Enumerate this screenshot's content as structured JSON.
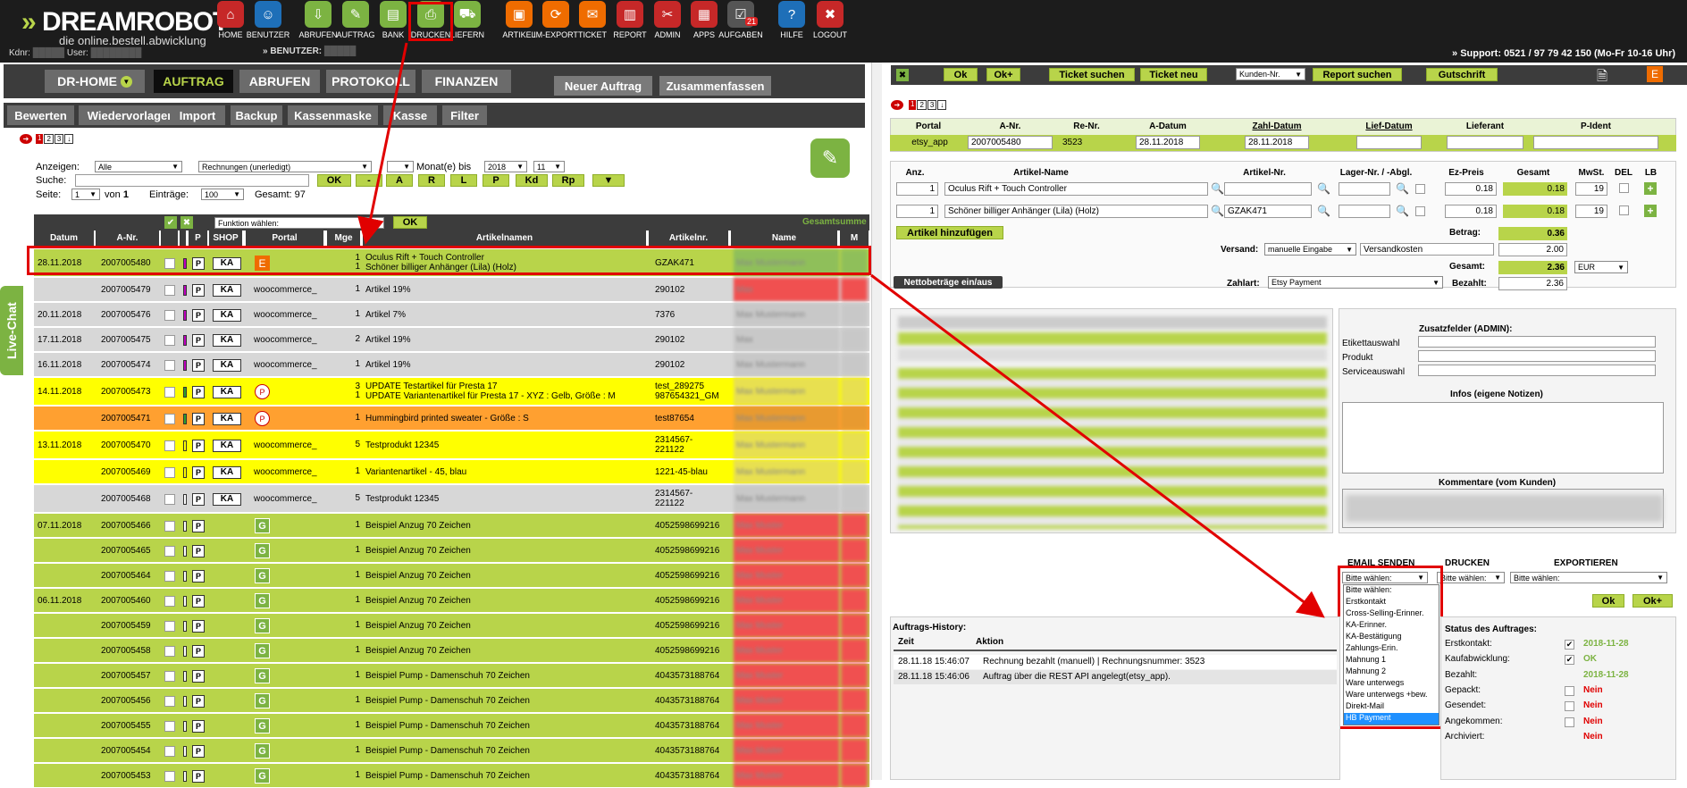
{
  "brand": {
    "name_a": "DREAM",
    "name_b": "ROBOT",
    "tagline": "die online.bestell.abwicklung",
    "kdnr_label": "Kdnr:",
    "user_label": "User:",
    "benutzer_label": "BENUTZER:",
    "support": "Support: 0521 / 97 79 42 150 (Mo-Fr 10-16 Uhr)"
  },
  "nav": [
    {
      "label": "HOME",
      "icon": "home-icon",
      "color": "#c62828"
    },
    {
      "label": "BENUTZER",
      "icon": "user-icon",
      "color": "#1e6fb8"
    },
    {
      "label": "ABRUFEN",
      "icon": "download-icon",
      "color": "#7cb342"
    },
    {
      "label": "AUFTRAG",
      "icon": "order-icon",
      "color": "#7cb342"
    },
    {
      "label": "BANK",
      "icon": "bank-icon",
      "color": "#7cb342"
    },
    {
      "label": "DRUCKEN",
      "icon": "printer-icon",
      "color": "#7cb342"
    },
    {
      "label": "LIEFERN",
      "icon": "delivery-icon",
      "color": "#7cb342"
    },
    {
      "label": "ARTIKEL",
      "icon": "box-icon",
      "color": "#ef6c00"
    },
    {
      "label": "IM-EXPORT",
      "icon": "sync-icon",
      "color": "#ef6c00"
    },
    {
      "label": "TICKET",
      "icon": "mail-icon",
      "color": "#ef6c00"
    },
    {
      "label": "REPORT",
      "icon": "report-icon",
      "color": "#c62828"
    },
    {
      "label": "ADMIN",
      "icon": "tools-icon",
      "color": "#c62828"
    },
    {
      "label": "APPS",
      "icon": "apps-icon",
      "color": "#c62828"
    },
    {
      "label": "AUFGABEN",
      "icon": "tasks-icon",
      "color": "#555555",
      "badge": "21"
    },
    {
      "label": "HILFE",
      "icon": "help-icon",
      "color": "#1e6fb8"
    },
    {
      "label": "LOGOUT",
      "icon": "logout-icon",
      "color": "#c62828"
    }
  ],
  "tabs": {
    "drhome": "DR-HOME",
    "auftrag": "AUFTRAG",
    "abrufen": "ABRUFEN",
    "protokoll": "PROTOKOLL",
    "finanzen": "FINANZEN",
    "neuer": "Neuer Auftrag",
    "zusammen": "Zusammenfassen"
  },
  "subtabs": [
    "Bewerten",
    "Wiedervorlagen",
    "Import",
    "Backup",
    "Kassenmaske",
    "Kasse",
    "Filter"
  ],
  "livechat": "Live-Chat",
  "filter": {
    "anzeigen": "Anzeigen:",
    "anzeigen_val": "Alle",
    "rechnungen": "Rechnungen (unerledigt)",
    "monat_bis": "Monat(e) bis",
    "jahr": "2018",
    "monat": "11",
    "suche": "Suche:",
    "seite": "Seite:",
    "seite_val": "1",
    "von": "von",
    "von_val": "1",
    "eintraege": "Einträge:",
    "eintraege_val": "100",
    "gesamt": "Gesamt: 97",
    "buttons": [
      "OK",
      "-",
      "A",
      "R",
      "L",
      "P",
      "Kd",
      "Rp"
    ],
    "funktion": "Funktion wählen:",
    "ok": "OK",
    "gesamtsumme": "Gesamtsumme"
  },
  "table": {
    "headers": [
      "Datum",
      "A-Nr.",
      "",
      "",
      "P",
      "SHOP",
      "Portal",
      "Mge",
      "Artikelnamen",
      "Artikelnr.",
      "Name",
      "M"
    ],
    "rows": [
      {
        "datum": "28.11.2018",
        "anr": "2007005480",
        "shop": "KA",
        "portal": "E",
        "mge": "1\n1",
        "artikel": "Oculus Rift + Touch Controller\nSchöner billiger Anhänger (Lila) (Holz)",
        "artnr": "GZAK471",
        "bg": "#b8d44a",
        "flag": "#c000c0",
        "name": "Max Mustermann",
        "namebg": "#8fbf5a"
      },
      {
        "datum": "",
        "anr": "2007005479",
        "shop": "KA",
        "portal": "woocommerce_",
        "mge": "1",
        "artikel": "Artikel 19%",
        "artnr": "290102",
        "bg": "#d7d7d7",
        "flag": "#c000c0",
        "name": "Max",
        "namebg": "#f05050"
      },
      {
        "datum": "20.11.2018",
        "anr": "2007005476",
        "shop": "KA",
        "portal": "woocommerce_",
        "mge": "1",
        "artikel": "Artikel 7%",
        "artnr": "7376",
        "bg": "#d7d7d7",
        "flag": "#c000c0",
        "name": "Max Mustermann",
        "namebg": "#c8c8c8"
      },
      {
        "datum": "17.11.2018",
        "anr": "2007005475",
        "shop": "KA",
        "portal": "woocommerce_",
        "mge": "2",
        "artikel": "Artikel 19%",
        "artnr": "290102",
        "bg": "#d7d7d7",
        "flag": "#c000c0",
        "name": "Max",
        "namebg": "#c8c8c8"
      },
      {
        "datum": "16.11.2018",
        "anr": "2007005474",
        "shop": "KA",
        "portal": "woocommerce_",
        "mge": "1",
        "artikel": "Artikel 19%",
        "artnr": "290102",
        "bg": "#d7d7d7",
        "flag": "#c000c0",
        "name": "Max Mustermann",
        "namebg": "#c8c8c8"
      },
      {
        "datum": "14.11.2018",
        "anr": "2007005473",
        "shop": "KA",
        "portal": "P",
        "mge": "3\n1",
        "artikel": "UPDATE Testartikel für Presta 17\nUPDATE Variantenartikel für Presta 17 - XYZ : Gelb, Größe : M",
        "artnr": "test_289275\n987654321_GM",
        "bg": "#ffff00",
        "flag": "#2e9e2e",
        "name": "Max Mustermann",
        "namebg": "#e8e050"
      },
      {
        "datum": "",
        "anr": "2007005471",
        "shop": "KA",
        "portal": "P",
        "mge": "1",
        "artikel": "Hummingbird printed sweater - Größe : S",
        "artnr": "test87654",
        "bg": "#ffa030",
        "flag": "#2e9e2e",
        "name": "Max Mustermann",
        "namebg": "#e89a30"
      },
      {
        "datum": "13.11.2018",
        "anr": "2007005470",
        "shop": "KA",
        "portal": "woocommerce_",
        "mge": "5",
        "artikel": "Testprodukt 12345",
        "artnr": "2314567-\n221122",
        "bg": "#ffff00",
        "flag": "#ffff00",
        "name": "Max Mustermann",
        "namebg": "#e8e050"
      },
      {
        "datum": "",
        "anr": "2007005469",
        "shop": "KA",
        "portal": "woocommerce_",
        "mge": "1",
        "artikel": "Variantenartikel - 45, blau",
        "artnr": "1221-45-blau",
        "bg": "#ffff00",
        "flag": "#ffff00",
        "name": "Max Mustermann",
        "namebg": "#e8e050"
      },
      {
        "datum": "",
        "anr": "2007005468",
        "shop": "KA",
        "portal": "woocommerce_",
        "mge": "5",
        "artikel": "Testprodukt 12345",
        "artnr": "2314567-\n221122",
        "bg": "#d7d7d7",
        "flag": "#ffffff",
        "name": "Max Mustermann",
        "namebg": "#c8c8c8"
      },
      {
        "datum": "07.11.2018",
        "anr": "2007005466",
        "shop": "",
        "portal": "G",
        "mge": "1",
        "artikel": "Beispiel Anzug 70 Zeichen",
        "artnr": "4052598699216",
        "bg": "#b8d44a",
        "flag": "#ffffff",
        "name": "Max Muster",
        "namebg": "#f05050"
      },
      {
        "datum": "",
        "anr": "2007005465",
        "shop": "",
        "portal": "G",
        "mge": "1",
        "artikel": "Beispiel Anzug 70 Zeichen",
        "artnr": "4052598699216",
        "bg": "#b8d44a",
        "flag": "#ffffff",
        "name": "Max Muster",
        "namebg": "#f05050"
      },
      {
        "datum": "",
        "anr": "2007005464",
        "shop": "",
        "portal": "G",
        "mge": "1",
        "artikel": "Beispiel Anzug 70 Zeichen",
        "artnr": "4052598699216",
        "bg": "#b8d44a",
        "flag": "#ffffff",
        "name": "Max Muster",
        "namebg": "#f05050"
      },
      {
        "datum": "06.11.2018",
        "anr": "2007005460",
        "shop": "",
        "portal": "G",
        "mge": "1",
        "artikel": "Beispiel Anzug 70 Zeichen",
        "artnr": "4052598699216",
        "bg": "#b8d44a",
        "flag": "#ffffff",
        "name": "Max Muster",
        "namebg": "#f05050"
      },
      {
        "datum": "",
        "anr": "2007005459",
        "shop": "",
        "portal": "G",
        "mge": "1",
        "artikel": "Beispiel Anzug 70 Zeichen",
        "artnr": "4052598699216",
        "bg": "#b8d44a",
        "flag": "#ffffff",
        "name": "Max Muster",
        "namebg": "#f05050"
      },
      {
        "datum": "",
        "anr": "2007005458",
        "shop": "",
        "portal": "G",
        "mge": "1",
        "artikel": "Beispiel Anzug 70 Zeichen",
        "artnr": "4052598699216",
        "bg": "#b8d44a",
        "flag": "#ffffff",
        "name": "Max Muster",
        "namebg": "#f05050"
      },
      {
        "datum": "",
        "anr": "2007005457",
        "shop": "",
        "portal": "G",
        "mge": "1",
        "artikel": "Beispiel Pump - Damenschuh 70 Zeichen",
        "artnr": "4043573188764",
        "bg": "#b8d44a",
        "flag": "#ffffff",
        "name": "Max Muster",
        "namebg": "#f05050"
      },
      {
        "datum": "",
        "anr": "2007005456",
        "shop": "",
        "portal": "G",
        "mge": "1",
        "artikel": "Beispiel Pump - Damenschuh 70 Zeichen",
        "artnr": "4043573188764",
        "bg": "#b8d44a",
        "flag": "#ffffff",
        "name": "Max Muster",
        "namebg": "#f05050"
      },
      {
        "datum": "",
        "anr": "2007005455",
        "shop": "",
        "portal": "G",
        "mge": "1",
        "artikel": "Beispiel Pump - Damenschuh 70 Zeichen",
        "artnr": "4043573188764",
        "bg": "#b8d44a",
        "flag": "#ffffff",
        "name": "Max Muster",
        "namebg": "#f05050"
      },
      {
        "datum": "",
        "anr": "2007005454",
        "shop": "",
        "portal": "G",
        "mge": "1",
        "artikel": "Beispiel Pump - Damenschuh 70 Zeichen",
        "artnr": "4043573188764",
        "bg": "#b8d44a",
        "flag": "#ffffff",
        "name": "Max Muster",
        "namebg": "#f05050"
      },
      {
        "datum": "",
        "anr": "2007005453",
        "shop": "",
        "portal": "G",
        "mge": "1",
        "artikel": "Beispiel Pump - Damenschuh 70 Zeichen",
        "artnr": "4043573188764",
        "bg": "#b8d44a",
        "flag": "#ffffff",
        "name": "Max Muster",
        "namebg": "#f05050"
      }
    ]
  },
  "right": {
    "toolbar": {
      "ok": "Ok",
      "okplus": "Ok+",
      "ticket_suchen": "Ticket suchen",
      "ticket_neu": "Ticket neu",
      "kunden_nr": "Kunden-Nr.",
      "report_suchen": "Report suchen",
      "gutschrift": "Gutschrift"
    },
    "head": {
      "labels": [
        "Portal",
        "A-Nr.",
        "Re-Nr.",
        "A-Datum",
        "Zahl-Datum",
        "Lief-Datum",
        "Lieferant",
        "P-Ident"
      ],
      "portal": "etsy_app",
      "anr": "2007005480",
      "renr": "3523",
      "adatum": "28.11.2018",
      "zahldatum": "28.11.2018"
    },
    "items_head": [
      "Anz.",
      "Artikel-Name",
      "Artikel-Nr.",
      "Lager-Nr. / -Abgl.",
      "Ez-Preis",
      "Gesamt",
      "MwSt.",
      "DEL",
      "LB"
    ],
    "items": [
      {
        "anz": "1",
        "name": "Oculus Rift + Touch Controller",
        "nr": "",
        "ez": "0.18",
        "gesamt": "0.18",
        "mwst": "19"
      },
      {
        "anz": "1",
        "name": "Schöner billiger Anhänger (Lila) (Holz)",
        "nr": "GZAK471",
        "ez": "0.18",
        "gesamt": "0.18",
        "mwst": "19"
      }
    ],
    "artikel_hinzufuegen": "Artikel hinzufügen",
    "betrag_label": "Betrag:",
    "betrag": "0.36",
    "versand_label": "Versand:",
    "versand_sel": "manuelle Eingabe",
    "versandkosten": "Versandkosten",
    "versand_val": "2.00",
    "gesamt_label": "Gesamt:",
    "gesamt": "2.36",
    "currency": "EUR",
    "netto": "Nettobeträge ein/aus",
    "zahlart_label": "Zahlart:",
    "zahlart": "Etsy Payment",
    "bezahlt_label": "Bezahlt:",
    "bezahlt": "2.36",
    "zusatz": "Zusatzfelder (ADMIN):",
    "etikett": "Etikettauswahl",
    "produkt": "Produkt",
    "service": "Serviceauswahl",
    "infos": "Infos (eigene Notizen)",
    "kommentare": "Kommentare (vom Kunden)",
    "email_senden": "EMAIL SENDEN",
    "drucken": "DRUCKEN",
    "exportieren": "EXPORTIEREN",
    "bitte": "Bitte wählen:",
    "dropdown": [
      "Bitte wählen:",
      "Erstkontakt",
      "Cross-Selling-Erinner.",
      "KA-Erinner.",
      "KA-Bestätigung",
      "Zahlungs-Erin.",
      "Mahnung 1",
      "Mahnung 2",
      "Ware unterwegs",
      "Ware unterwegs +bew.",
      "Direkt-Mail",
      "HB Payment"
    ],
    "ok": "Ok",
    "okplus": "Ok+",
    "history_title": "Auftrags-History:",
    "zeit": "Zeit",
    "aktion": "Aktion",
    "history": [
      {
        "zeit": "28.11.18 15:46:07",
        "aktion": "Rechnung bezahlt (manuell) | Rechnungsnummer: 3523"
      },
      {
        "zeit": "28.11.18 15:46:06",
        "aktion": "Auftrag über die REST API angelegt(etsy_app)."
      }
    ],
    "status_title": "Status des Auftrages:",
    "status": [
      {
        "label": "Erstkontakt:",
        "checked": true,
        "val": "2018-11-28",
        "color": "#7cb342"
      },
      {
        "label": "Kaufabwicklung:",
        "checked": true,
        "val": "OK",
        "color": "#7cb342"
      },
      {
        "label": "Bezahlt:",
        "checked": null,
        "val": "2018-11-28",
        "color": "#7cb342"
      },
      {
        "label": "Gepackt:",
        "checked": false,
        "val": "Nein",
        "color": "#e00000"
      },
      {
        "label": "Gesendet:",
        "checked": false,
        "val": "Nein",
        "color": "#e00000"
      },
      {
        "label": "Angekommen:",
        "checked": false,
        "val": "Nein",
        "color": "#e00000"
      },
      {
        "label": "Archiviert:",
        "checked": null,
        "val": "Nein",
        "color": "#e00000"
      }
    ]
  }
}
